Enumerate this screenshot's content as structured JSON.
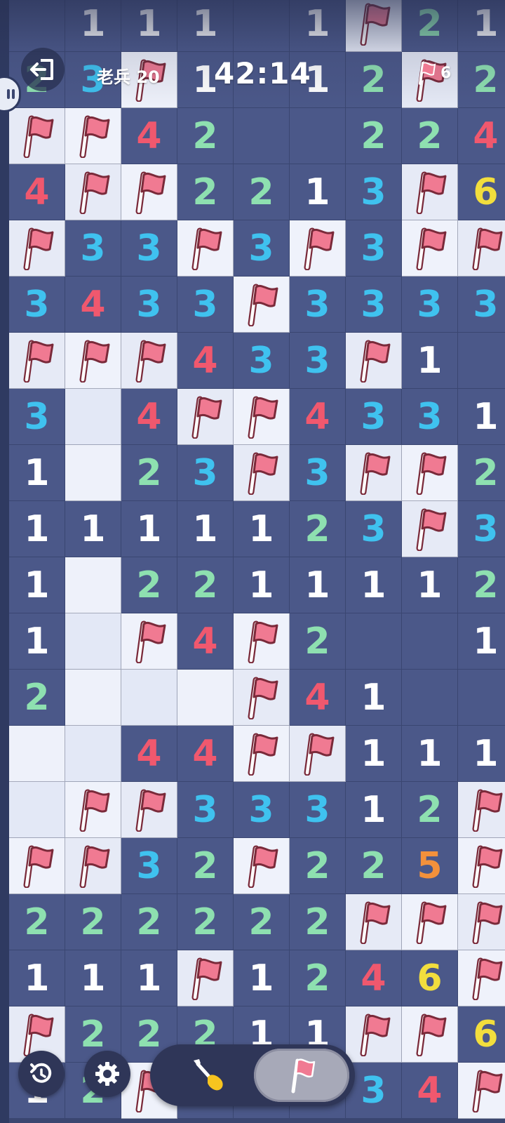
{
  "hud": {
    "level_label": "老兵 20",
    "timer": "42:14",
    "flags_remaining": "6"
  },
  "colors": {
    "1": "#ffffff",
    "2": "#8ee0b0",
    "3": "#3fc2ef",
    "4": "#f0586e",
    "5": "#f3913b",
    "6": "#f2de3d",
    "flag": "#f07a92"
  },
  "board": [
    [
      "-",
      "1",
      "1",
      "1",
      "-",
      "1",
      "F",
      "2",
      "1"
    ],
    [
      "2",
      "3",
      "F",
      "1",
      "-",
      "1",
      "2",
      "F",
      "2"
    ],
    [
      "F",
      "F",
      "4",
      "2",
      "-",
      "-",
      "2",
      "2",
      "4"
    ],
    [
      "4",
      "F",
      "F",
      "2",
      "2",
      "1",
      "3",
      "F",
      "6"
    ],
    [
      "F",
      "3",
      "3",
      "F",
      "3",
      "F",
      "3",
      "F",
      "F"
    ],
    [
      "3",
      "4",
      "3",
      "3",
      "F",
      "3",
      "3",
      "3",
      "3"
    ],
    [
      "F",
      "F",
      "F",
      "4",
      "3",
      "3",
      "F",
      "1",
      "-"
    ],
    [
      "3",
      "H",
      "4",
      "F",
      "F",
      "4",
      "3",
      "3",
      "1"
    ],
    [
      "1",
      "H",
      "2",
      "3",
      "F",
      "3",
      "F",
      "F",
      "2"
    ],
    [
      "1",
      "1",
      "1",
      "1",
      "1",
      "2",
      "3",
      "F",
      "3"
    ],
    [
      "1",
      "H",
      "2",
      "2",
      "1",
      "1",
      "1",
      "1",
      "2"
    ],
    [
      "1",
      "H",
      "F",
      "4",
      "F",
      "2",
      "-",
      "-",
      "1"
    ],
    [
      "2",
      "H",
      "H",
      "H",
      "F",
      "4",
      "1",
      "-",
      "-"
    ],
    [
      "H",
      "H",
      "4",
      "4",
      "F",
      "F",
      "1",
      "1",
      "1"
    ],
    [
      "H",
      "F",
      "F",
      "3",
      "3",
      "3",
      "1",
      "2",
      "F"
    ],
    [
      "F",
      "F",
      "3",
      "2",
      "F",
      "2",
      "2",
      "5",
      "F"
    ],
    [
      "2",
      "2",
      "2",
      "2",
      "2",
      "2",
      "F",
      "F",
      "F"
    ],
    [
      "1",
      "1",
      "1",
      "F",
      "1",
      "2",
      "4",
      "6",
      "F"
    ],
    [
      "F",
      "2",
      "2",
      "2",
      "1",
      "1",
      "F",
      "F",
      "6"
    ],
    [
      "1",
      "2",
      "F",
      "1",
      "1",
      "2",
      "3",
      "4",
      "F"
    ]
  ]
}
